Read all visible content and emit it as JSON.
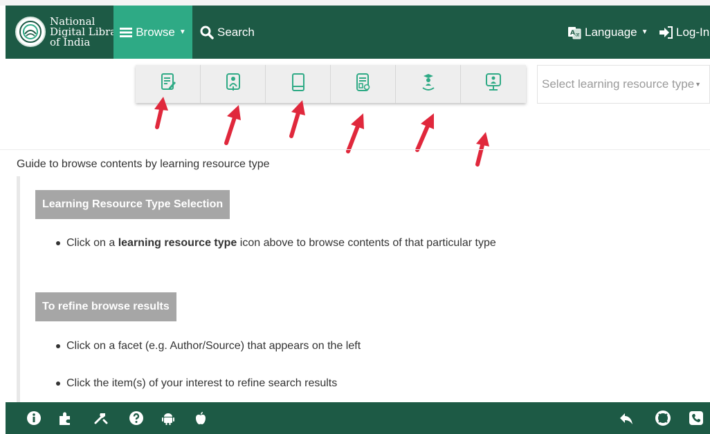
{
  "header": {
    "logo_lines": [
      "National",
      "Digital Library",
      "of India"
    ],
    "browse_label": "Browse",
    "search_label": "Search",
    "language_label": "Language",
    "login_label": "Log-In"
  },
  "resource_types": {
    "icons": [
      "document-edit-icon",
      "presentation-icon",
      "book-icon",
      "report-icon",
      "graduate-icon",
      "lecture-icon"
    ],
    "select_placeholder": "Select learning resource type"
  },
  "guide": {
    "title": "Guide to browse contents by learning resource type",
    "sections": [
      {
        "heading": "Learning Resource Type Selection",
        "bullets": [
          {
            "pre": "Click on a ",
            "bold": "learning resource type",
            "post": " icon above to browse contents of that particular type"
          }
        ]
      },
      {
        "heading": "To refine browse results",
        "bullets": [
          {
            "pre": "Click on a facet (e.g. Author/Source) that appears on the left",
            "bold": "",
            "post": ""
          },
          {
            "pre": "Click the item(s) of your interest to refine search results",
            "bold": "",
            "post": ""
          }
        ]
      }
    ]
  },
  "footer": {
    "left_icons": [
      "info-icon",
      "puzzle-icon",
      "tools-icon",
      "help-icon",
      "android-icon",
      "apple-icon"
    ],
    "right_icons": [
      "back-icon",
      "lifebuoy-icon",
      "phone-icon"
    ]
  },
  "colors": {
    "header_bg": "#1d5a45",
    "browse_active_bg": "#2eaa85",
    "icon_green": "#2eaa85",
    "arrow_red": "#e0283c",
    "section_head_bg": "#a6a6a6"
  }
}
